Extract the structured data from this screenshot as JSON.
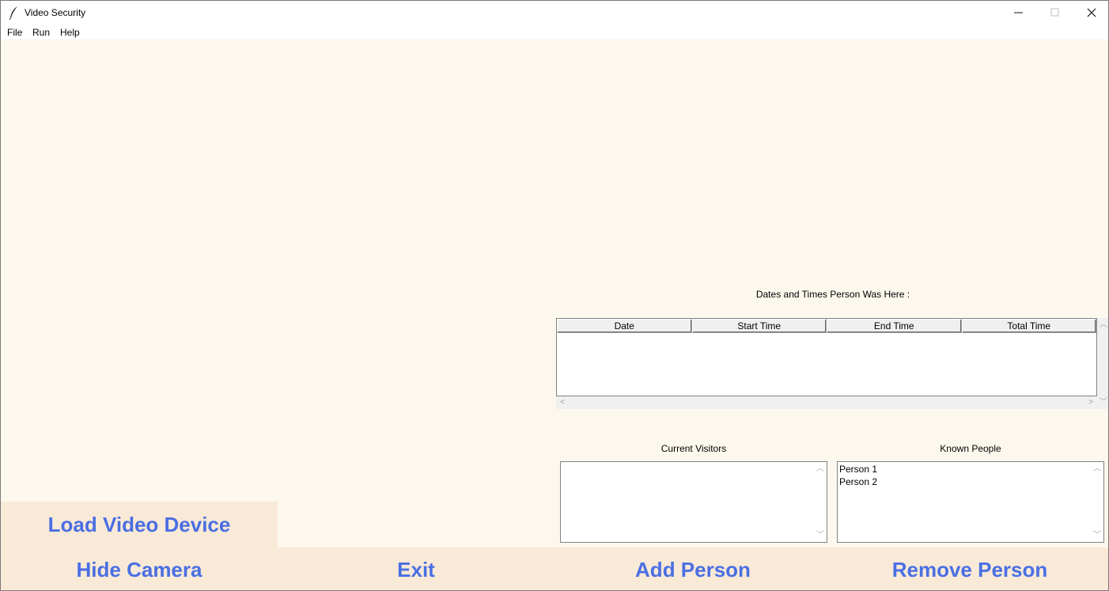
{
  "window": {
    "title": "Video Security",
    "controls": {
      "minimize": "—",
      "maximize": "☐",
      "close": "✕"
    }
  },
  "menu": {
    "items": [
      "File",
      "Run",
      "Help"
    ]
  },
  "history": {
    "label": "Dates and Times Person Was Here :",
    "columns": [
      "Date",
      "Start Time",
      "End Time",
      "Total Time"
    ]
  },
  "visitors": {
    "label": "Current Visitors",
    "items": []
  },
  "known": {
    "label": "Known People",
    "items": [
      "Person 1",
      "Person 2"
    ]
  },
  "buttons": {
    "load_video": "Load Video Device",
    "hide_camera": "Hide Camera",
    "exit": "Exit",
    "add_person": "Add Person",
    "remove_person": "Remove Person"
  },
  "colors": {
    "accent_text": "#4a6fe3",
    "button_bg": "#f9e9d7",
    "window_bg": "#fdf8ee"
  }
}
